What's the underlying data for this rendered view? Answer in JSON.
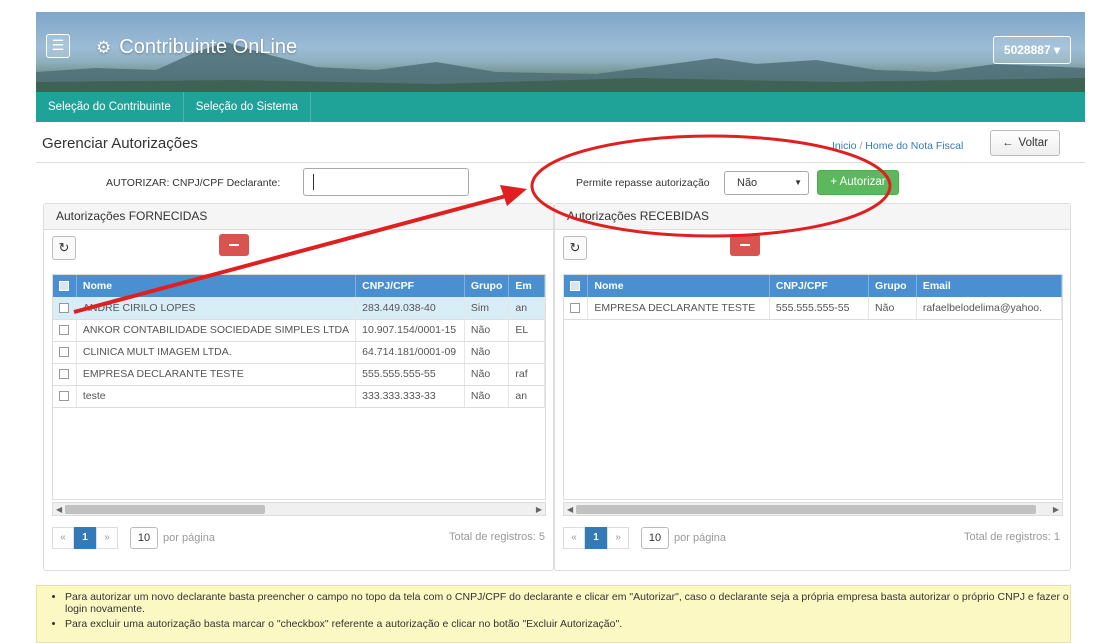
{
  "header": {
    "app_title": "Contribuinte OnLine",
    "user_code": "5028887",
    "menu_icon": "hamburger-icon",
    "brand_icon": "gear-icon"
  },
  "nav": {
    "items": [
      "Seleção do Contribuinte",
      "Seleção do Sistema"
    ]
  },
  "page": {
    "title": "Gerenciar Autorizações",
    "breadcrumb": [
      "Inicio",
      "Home do Nota Fiscal"
    ],
    "breadcrumb_sep": "/",
    "back_label": "Voltar"
  },
  "form": {
    "autorizar_label": "AUTORIZAR: CNPJ/CPF Declarante:",
    "autorizar_value": "",
    "repasse_label": "Permite repasse autorização",
    "repasse_value": "Não",
    "autorizar_button": "+ Autorizar"
  },
  "fornecidas": {
    "title": "Autorizações FORNECIDAS",
    "columns": [
      "Nome",
      "CNPJ/CPF",
      "Grupo",
      "Em"
    ],
    "rows": [
      [
        "ANDRE CIRILO LOPES",
        "283.449.038-40",
        "Sim",
        "an"
      ],
      [
        "ANKOR CONTABILIDADE SOCIEDADE SIMPLES LTDA",
        "10.907.154/0001-15",
        "Não",
        "EL"
      ],
      [
        "CLINICA MULT IMAGEM LTDA.",
        "64.714.181/0001-09",
        "Não",
        ""
      ],
      [
        "EMPRESA DECLARANTE TESTE",
        "555.555.555-55",
        "Não",
        "raf"
      ],
      [
        "teste",
        "333.333.333-33",
        "Não",
        "an"
      ]
    ],
    "page": "1",
    "per_page": "10",
    "per_page_label": "por página",
    "total": "Total de registros: 5"
  },
  "recebidas": {
    "title": "Autorizações RECEBIDAS",
    "columns": [
      "Nome",
      "CNPJ/CPF",
      "Grupo",
      "Email"
    ],
    "rows": [
      [
        "EMPRESA DECLARANTE TESTE",
        "555.555.555-55",
        "Não",
        "rafaelbelodelima@yahoo."
      ]
    ],
    "page": "1",
    "per_page": "10",
    "per_page_label": "por página",
    "total": "Total de registros: 1"
  },
  "info": {
    "line1": "Para autorizar um novo declarante basta preencher o campo no topo da tela com o CNPJ/CPF do declarante e clicar em \"Autorizar\", caso o declarante seja a própria empresa basta autorizar o próprio CNPJ e fazer o login novamente.",
    "line2": "Para excluir uma autorização basta marcar o \"checkbox\" referente a autorização e clicar no botão \"Excluir Autorização\"."
  },
  "annotation": {
    "color": "#e02020"
  }
}
